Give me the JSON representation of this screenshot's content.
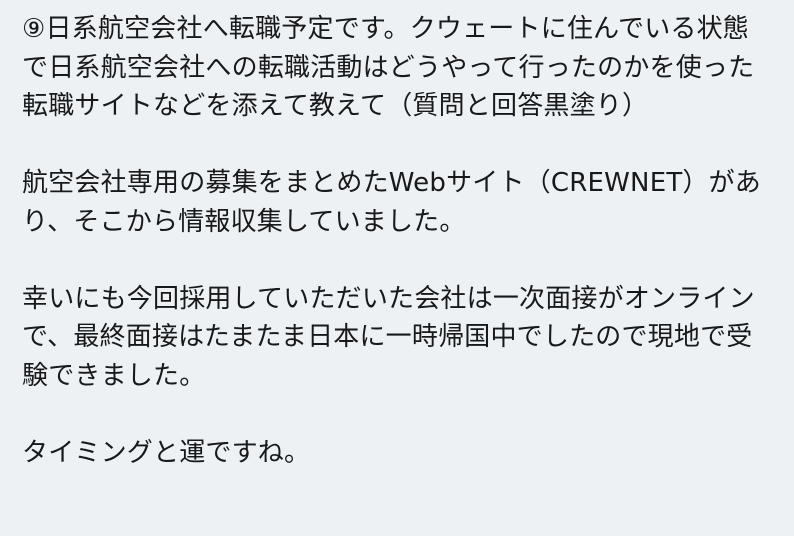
{
  "post": {
    "question": "⑨日系航空会社へ転職予定です。クウェートに住んでいる状態で日系航空会社への転職活動はどうやって行ったのかを使った転職サイトなどを添えて教えて（質問と回答黒塗り）",
    "paragraph_1": "航空会社専用の募集をまとめたWebサイト（CREWNET）があり、そこから情報収集していました。",
    "paragraph_2": "幸いにも今回採用していただいた会社は一次面接がオンラインで、最終面接はたまたま日本に一時帰国中でしたので現地で受験できました。",
    "paragraph_3": "タイミングと運ですね。"
  }
}
